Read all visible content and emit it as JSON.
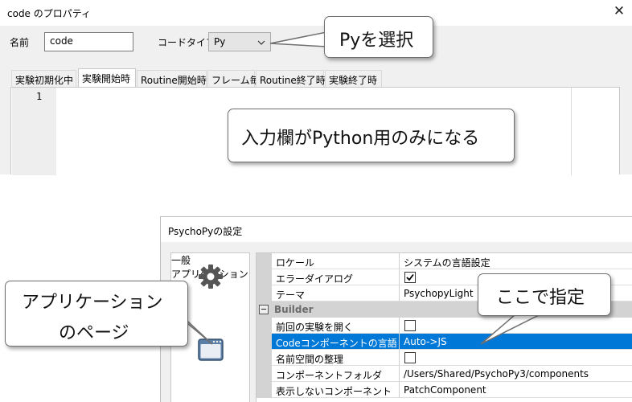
{
  "code_dialog": {
    "title": "code のプロパティ",
    "close_glyph": "✕",
    "name_label": "名前",
    "name_value": "code",
    "code_type_label": "コードタイプ",
    "code_type_value": "Py",
    "tabs": [
      "実験初期化中",
      "実験開始時",
      "Routine開始時",
      "フレーム毎",
      "Routine終了時",
      "実験終了時"
    ],
    "active_tab": "実験開始時",
    "line_number": "1"
  },
  "settings_dialog": {
    "title": "PsychoPyの設定",
    "categories": [
      {
        "label": "一般",
        "icon": "gear-icon"
      },
      {
        "label": "アプリケーション",
        "icon": "application-window-icon"
      }
    ],
    "rows": [
      {
        "key": "ロケール",
        "value": "システムの言語設定"
      },
      {
        "key": "エラーダイアログ",
        "value": "",
        "checked": true
      },
      {
        "key": "テーマ",
        "value": "PsychopyLight"
      },
      {
        "group": "Builder"
      },
      {
        "key": "前回の実験を開く",
        "value": "",
        "checked": false
      },
      {
        "key": "Codeコンポーネントの言語",
        "value": "Auto->JS",
        "selected": true
      },
      {
        "key": "名前空間の整理",
        "value": "",
        "checked": false
      },
      {
        "key": "コンポーネントフォルダ",
        "value": "/Users/Shared/PsychoPy3/components"
      },
      {
        "key": "表示しないコンポーネント",
        "value": "PatchComponent"
      }
    ],
    "accent_color": "#0078d7"
  },
  "callouts": {
    "select_py": "Pyを選択",
    "python_only": "入力欄がPython用のみになる",
    "app_page_line1": "アプリケーション",
    "app_page_line2": "のページ",
    "specify_here": "ここで指定"
  }
}
